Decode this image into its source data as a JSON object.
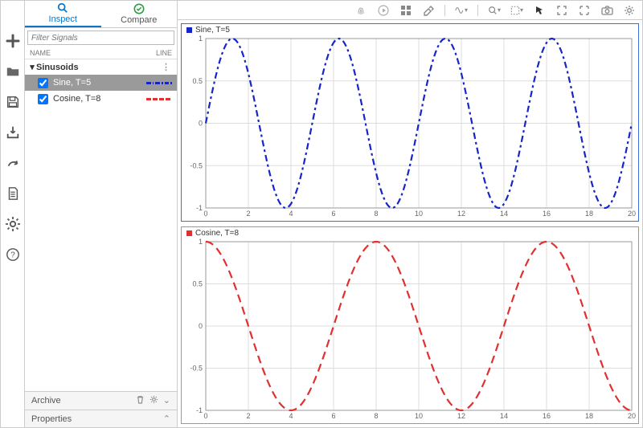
{
  "tabs": {
    "inspect": "Inspect",
    "compare": "Compare"
  },
  "filter_placeholder": "Filter Signals",
  "columns": {
    "name": "NAME",
    "line": "LINE"
  },
  "group": {
    "label": "Sinusoids"
  },
  "signals": [
    {
      "name": "Sine, T=5",
      "checked": true,
      "selected": true,
      "color": "#1626c6",
      "style": "dashdot"
    },
    {
      "name": "Cosine, T=8",
      "checked": true,
      "selected": false,
      "color": "#e03030",
      "style": "dash"
    }
  ],
  "footer": {
    "archive": "Archive",
    "properties": "Properties"
  },
  "chart_data": [
    {
      "type": "line",
      "title": "Sine, T=5",
      "xlabel": "",
      "ylabel": "",
      "xlim": [
        0,
        20
      ],
      "ylim": [
        -1.0,
        1.0
      ],
      "xticks": [
        0,
        2,
        4,
        6,
        8,
        10,
        12,
        14,
        16,
        18,
        20
      ],
      "yticks": [
        -1.0,
        -0.5,
        0,
        0.5,
        1.0
      ],
      "series": [
        {
          "name": "Sine, T=5",
          "color": "#1626c6",
          "dash": "8 4 3 4",
          "fn": "sin",
          "period": 5,
          "amplitude": 1.0,
          "phase": 0,
          "sample_x": [
            0,
            1.25,
            2.5,
            3.75,
            5,
            6.25,
            7.5,
            8.75,
            10,
            11.25,
            12.5,
            13.75,
            15,
            16.25,
            17.5,
            18.75,
            20
          ],
          "sample_y": [
            0,
            1,
            0,
            -1,
            0,
            1,
            0,
            -1,
            0,
            1,
            0,
            -1,
            0,
            1,
            0,
            -1,
            0
          ]
        }
      ]
    },
    {
      "type": "line",
      "title": "Cosine, T=8",
      "xlabel": "",
      "ylabel": "",
      "xlim": [
        0,
        20
      ],
      "ylim": [
        -1.0,
        1.0
      ],
      "xticks": [
        0,
        2,
        4,
        6,
        8,
        10,
        12,
        14,
        16,
        18,
        20
      ],
      "yticks": [
        -1.0,
        -0.5,
        0,
        0.5,
        1.0
      ],
      "series": [
        {
          "name": "Cosine, T=8",
          "color": "#e03030",
          "dash": "10 6",
          "fn": "cos",
          "period": 8,
          "amplitude": 1.0,
          "phase": 0,
          "sample_x": [
            0,
            2,
            4,
            6,
            8,
            10,
            12,
            14,
            16,
            18,
            20
          ],
          "sample_y": [
            1,
            0,
            -1,
            0,
            1,
            0,
            -1,
            0,
            1,
            0,
            -1
          ]
        }
      ]
    }
  ]
}
